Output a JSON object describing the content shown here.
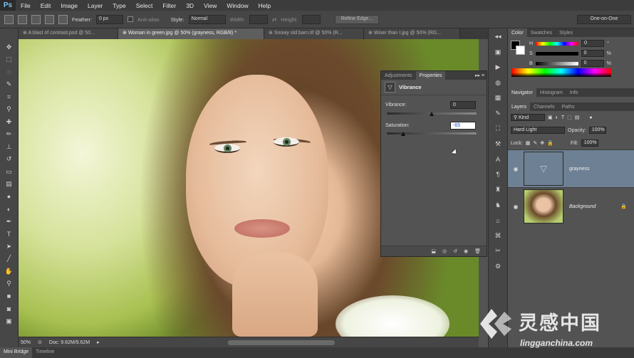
{
  "app": {
    "logo": "Ps"
  },
  "menu": [
    "File",
    "Edit",
    "Image",
    "Layer",
    "Type",
    "Select",
    "Filter",
    "3D",
    "View",
    "Window",
    "Help"
  ],
  "options": {
    "feather_label": "Feather:",
    "feather_value": "0 px",
    "antialias_label": "Anti-alias",
    "style_label": "Style:",
    "style_value": "Normal",
    "width_label": "Width:",
    "height_label": "Height:",
    "refine_edge": "Refine Edge...",
    "workspace": "One-on-One"
  },
  "doc_tabs": [
    {
      "label": "A blast of contrast.psd @ 50...",
      "active": false
    },
    {
      "label": "Woman in green.jpg @ 50% (grayness, RGB/8) *",
      "active": true
    },
    {
      "label": "Snowy old barn.tif @ 50% (R...",
      "active": false
    },
    {
      "label": "Wiser than I.jpg @ 50% (RG...",
      "active": false
    }
  ],
  "properties": {
    "tabs": [
      "Adjustments",
      "Properties"
    ],
    "title": "Vibrance",
    "vibrance_label": "Vibrance:",
    "vibrance_value": "0",
    "vibrance_level": 0.5,
    "saturation_label": "Saturation:",
    "saturation_value": "-65",
    "saturation_level": 0.18
  },
  "color_panel": {
    "tabs": [
      "Color",
      "Swatches",
      "Styles"
    ],
    "h_label": "H",
    "h_value": "0",
    "h_unit": "°",
    "s_label": "S",
    "s_value": "0",
    "s_unit": "%",
    "b_label": "B",
    "b_value": "0",
    "b_unit": "%"
  },
  "nav_panel": {
    "tabs": [
      "Navigator",
      "Histogram",
      "Info"
    ]
  },
  "layers_panel": {
    "tabs": [
      "Layers",
      "Channels",
      "Paths"
    ],
    "kind": "Kind",
    "blend_mode": "Hard Light",
    "opacity_label": "Opacity:",
    "opacity_value": "100%",
    "lock_label": "Lock:",
    "fill_label": "Fill:",
    "fill_value": "100%",
    "layers": [
      {
        "name": "grayness",
        "selected": true
      },
      {
        "name": "Background",
        "selected": false
      }
    ]
  },
  "status": {
    "zoom": "50%",
    "doc": "Doc: 9.62M/9.62M"
  },
  "bottom_tabs": [
    "Mini Bridge",
    "Timeline"
  ],
  "watermark": {
    "cn": "灵感中国",
    "url": "lingganchina.com"
  },
  "colors": {
    "menubar": "#3c3c3c",
    "panel": "#535353",
    "selected_layer": "#6e8093",
    "accent": "#1a55c0"
  }
}
